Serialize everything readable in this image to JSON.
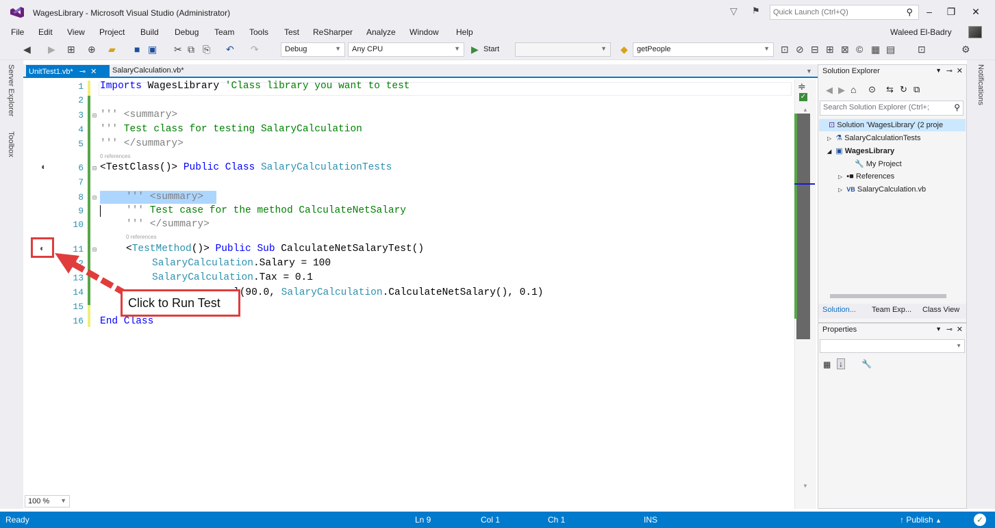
{
  "window": {
    "title": "WagesLibrary - Microsoft Visual Studio (Administrator)",
    "quick_launch_placeholder": "Quick Launch (Ctrl+Q)",
    "user_name": "Waleed El-Badry"
  },
  "menu": [
    "File",
    "Edit",
    "View",
    "Project",
    "Build",
    "Debug",
    "Team",
    "Tools",
    "Test",
    "ReSharper",
    "Analyze",
    "Window",
    "Help"
  ],
  "toolbar": {
    "config": "Debug",
    "platform": "Any CPU",
    "start_label": "Start",
    "member_combo": "getPeople"
  },
  "side_tabs": {
    "left": [
      "Server Explorer",
      "Toolbox"
    ],
    "right": "Notifications"
  },
  "tabs": {
    "active": "UnitTest1.vb*",
    "inactive": "SalaryCalculation.vb*"
  },
  "editor": {
    "line_numbers": [
      "1",
      "2",
      "3",
      "4",
      "5",
      "6",
      "7",
      "8",
      "9",
      "10",
      "11",
      "12",
      "13",
      "14",
      "15",
      "16"
    ],
    "codelens": "0 references",
    "zoom": "100 %",
    "lines": {
      "l1_kw": "Imports",
      "l1_text": " WagesLibrary ",
      "l1_comment": "'Class library you want to test",
      "l3_xd": "''' <summary>",
      "l4_xd": "'''",
      "l4_text": " Test class for testing SalaryCalculation",
      "l5_xd": "''' </summary>",
      "l6_a": "<TestClass()> ",
      "l6_kw": "Public Class",
      "l6_ty": " SalaryCalculationTests",
      "l8_xd": "''' <summary>",
      "l9_xd": "'''",
      "l9_text": " Test case for the method CalculateNetSalary",
      "l10_xd": "''' </summary>",
      "l11_a": "<",
      "l11_ty": "TestMethod",
      "l11_b": "()> ",
      "l11_kw": "Public Sub",
      "l11_c": " CalculateNetSalaryTest()",
      "l12_ty": "SalaryCalculation",
      "l12_text": ".Salary = 100",
      "l13_ty": "SalaryCalculation",
      "l13_text": ".Tax = 0.1",
      "l14_a": "l(90.0, ",
      "l14_ty": "SalaryCalculation",
      "l14_b": ".CalculateNetSalary(), 0.1)",
      "l16_kw": "End Class"
    }
  },
  "callout": "Click to Run Test",
  "solution_explorer": {
    "title": "Solution Explorer",
    "search_placeholder": "Search Solution Explorer (Ctrl+;",
    "tree": [
      "Solution 'WagesLibrary' (2 proje",
      "SalaryCalculationTests",
      "WagesLibrary",
      "My Project",
      "References",
      "SalaryCalculation.vb"
    ],
    "bottom_tabs": [
      "Solution...",
      "Team Exp...",
      "Class View"
    ]
  },
  "properties": {
    "title": "Properties"
  },
  "status": {
    "ready": "Ready",
    "ln": "Ln 9",
    "col": "Col 1",
    "ch": "Ch 1",
    "ins": "INS",
    "publish": "Publish"
  }
}
